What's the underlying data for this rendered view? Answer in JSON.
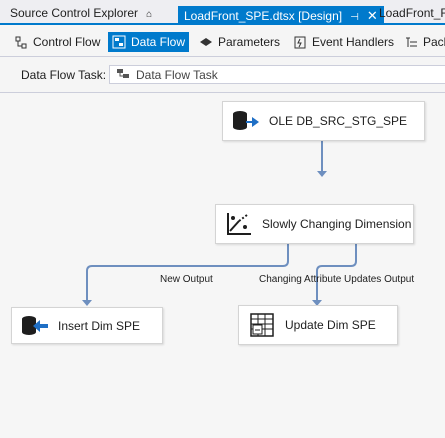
{
  "tabs": [
    {
      "label": "Source Control Explorer",
      "pin": "⌂"
    },
    {
      "label": "LoadFront_SPE.dtsx [Design]",
      "pin": "⊣",
      "close": "✕"
    },
    {
      "label": "LoadFront_R"
    }
  ],
  "subtabs": [
    {
      "label": "Control Flow",
      "icon": "control-flow-icon"
    },
    {
      "label": "Data Flow",
      "icon": "data-flow-icon"
    },
    {
      "label": "Parameters",
      "icon": "parameters-icon"
    },
    {
      "label": "Event Handlers",
      "icon": "event-handlers-icon"
    },
    {
      "label": "Pacl",
      "icon": "package-explorer-icon"
    }
  ],
  "task": {
    "label": "Data Flow Task:",
    "value": "Data Flow Task"
  },
  "nodes": {
    "source": "OLE DB_SRC_STG_SPE",
    "scd": "Slowly Changing Dimension",
    "insert": "Insert Dim SPE",
    "update": "Update Dim SPE"
  },
  "outputs": {
    "new": "New Output",
    "changing": "Changing Attribute Updates Output"
  },
  "colors": {
    "accent": "#007acc",
    "wire": "#6e8fbf"
  }
}
